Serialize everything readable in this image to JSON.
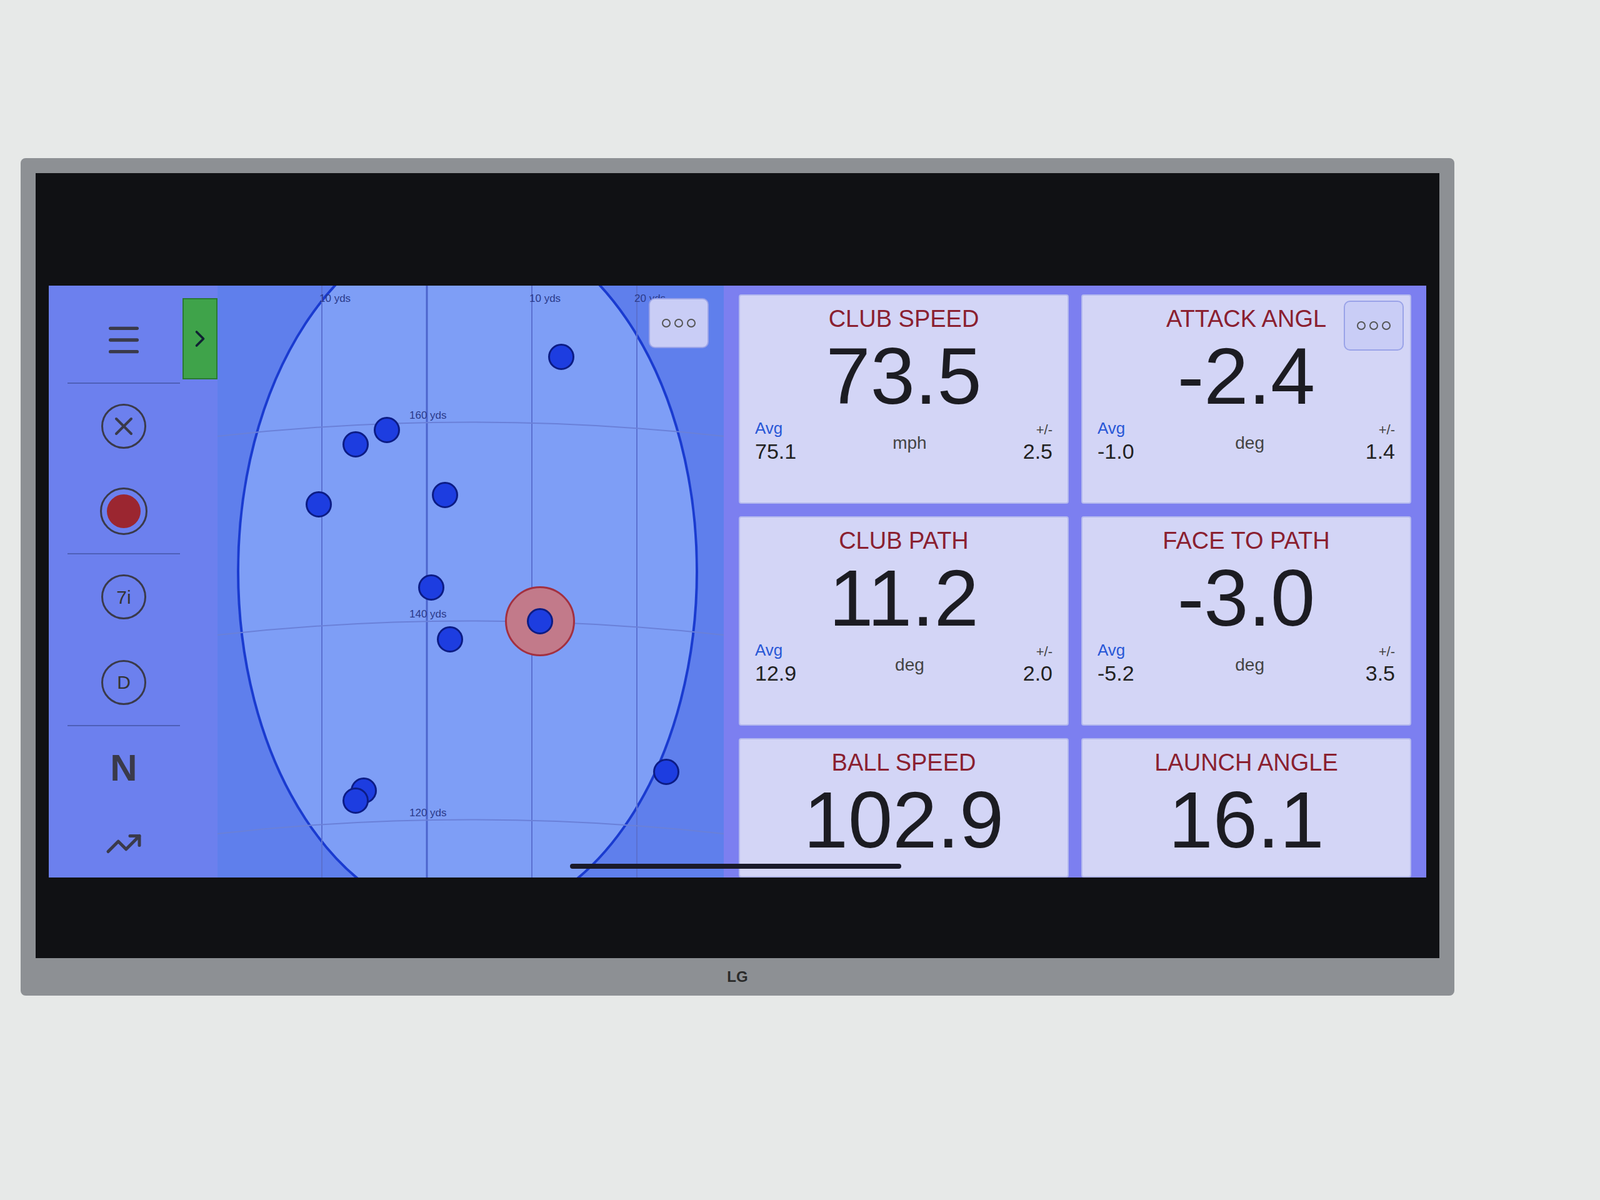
{
  "tv": {
    "brand": "LG"
  },
  "sidebar": {
    "expand_tab": true,
    "items": [
      {
        "kind": "menu"
      },
      {
        "kind": "clear"
      },
      {
        "kind": "record",
        "on": true
      },
      {
        "kind": "club",
        "label": "7i"
      },
      {
        "kind": "club",
        "label": "D"
      },
      {
        "kind": "text",
        "label": "N"
      },
      {
        "kind": "trend"
      }
    ]
  },
  "map": {
    "lateral_lines": [
      {
        "label": "10 yds",
        "yds": -10
      },
      {
        "label": "10 yds",
        "yds": 10
      },
      {
        "label": "20 yds",
        "yds": 20
      }
    ],
    "distance_lines": [
      {
        "label": "160 yds",
        "yds": 160
      },
      {
        "label": "140 yds",
        "yds": 140
      },
      {
        "label": "120 yds",
        "yds": 120
      }
    ],
    "shots": [
      {
        "offline": 12.8,
        "carry": 166.7,
        "selected": false
      },
      {
        "offline": -6.8,
        "carry": 157.9,
        "selected": false
      },
      {
        "offline": -3.8,
        "carry": 159.4,
        "selected": false
      },
      {
        "offline": -10.3,
        "carry": 151.9,
        "selected": false
      },
      {
        "offline": 1.7,
        "carry": 152.8,
        "selected": false
      },
      {
        "offline": 0.4,
        "carry": 143.5,
        "selected": false
      },
      {
        "offline": 2.2,
        "carry": 138.3,
        "selected": false
      },
      {
        "offline": 10.8,
        "carry": 140.1,
        "selected": true
      },
      {
        "offline": -6.0,
        "carry": 123.1,
        "selected": false
      },
      {
        "offline": -6.8,
        "carry": 122.1,
        "selected": false
      },
      {
        "offline": 22.8,
        "carry": 125.0,
        "selected": false
      }
    ]
  },
  "metrics": [
    {
      "title": "CLUB SPEED",
      "value": "73.5",
      "avg_label": "Avg",
      "avg": "75.1",
      "unit": "mph",
      "spread_label": "+/-",
      "spread": "2.5",
      "menu": false
    },
    {
      "title": "ATTACK ANGL",
      "value": "-2.4",
      "avg_label": "Avg",
      "avg": "-1.0",
      "unit": "deg",
      "spread_label": "+/-",
      "spread": "1.4",
      "menu": true
    },
    {
      "title": "CLUB PATH",
      "value": "11.2",
      "avg_label": "Avg",
      "avg": "12.9",
      "unit": "deg",
      "spread_label": "+/-",
      "spread": "2.0",
      "menu": false
    },
    {
      "title": "FACE TO PATH",
      "value": "-3.0",
      "avg_label": "Avg",
      "avg": "-5.2",
      "unit": "deg",
      "spread_label": "+/-",
      "spread": "3.5",
      "menu": false
    },
    {
      "title": "BALL SPEED",
      "value": "102.9",
      "menu": false
    },
    {
      "title": "LAUNCH ANGLE",
      "value": "16.1",
      "menu": false
    }
  ]
}
